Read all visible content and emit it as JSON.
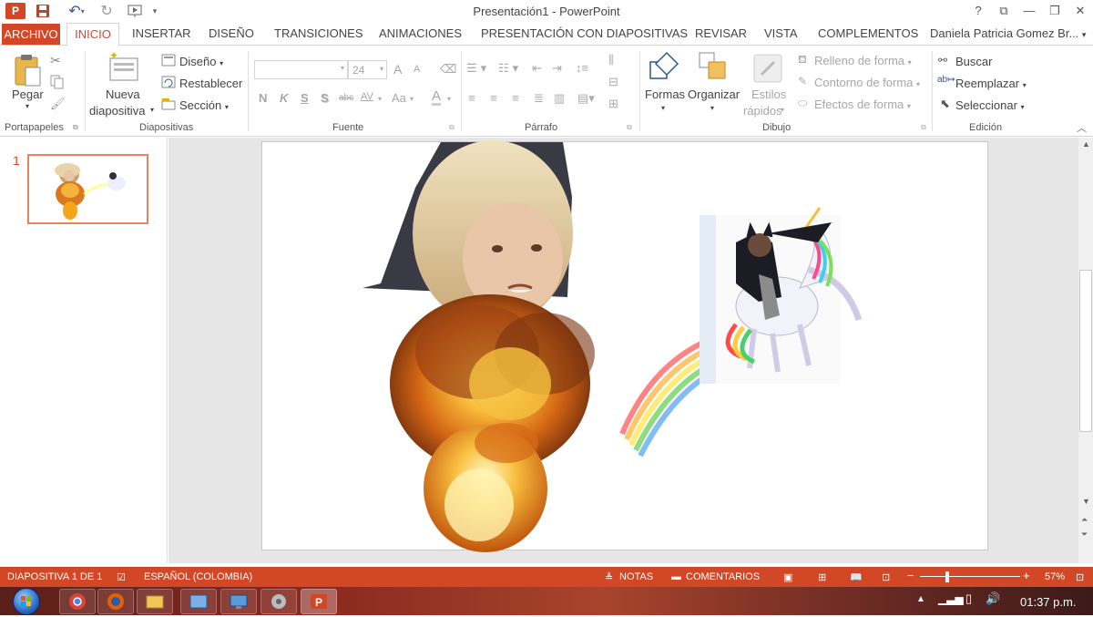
{
  "app": {
    "title": "Presentación1 - PowerPoint",
    "user": "Daniela Patricia Gomez Br..."
  },
  "window_controls": {
    "help": "?",
    "restore_ribbon": "⧉",
    "minimize": "—",
    "maximize": "❐",
    "close": "✕"
  },
  "tabs": [
    "ARCHIVO",
    "INICIO",
    "INSERTAR",
    "DISEÑO",
    "TRANSICIONES",
    "ANIMACIONES",
    "PRESENTACIÓN CON DIAPOSITIVAS",
    "REVISAR",
    "VISTA",
    "COMPLEMENTOS"
  ],
  "ribbon": {
    "clipboard": {
      "paste": "Pegar",
      "label": "Portapapeles"
    },
    "slides": {
      "new_slide_1": "Nueva",
      "new_slide_2": "diapositiva",
      "layout": "Diseño",
      "reset": "Restablecer",
      "section": "Sección",
      "label": "Diapositivas"
    },
    "font": {
      "size": "24",
      "bold": "N",
      "italic": "K",
      "underline": "S",
      "shadow": "S",
      "strike": "abc",
      "spacing": "AV",
      "case": "Aa",
      "color": "A",
      "grow": "A",
      "shrink": "A",
      "label": "Fuente"
    },
    "paragraph": {
      "label": "Párrafo"
    },
    "drawing": {
      "shapes": "Formas",
      "arrange": "Organizar",
      "quick_styles_1": "Estilos",
      "quick_styles_2": "rápidos",
      "fill": "Relleno de forma",
      "outline": "Contorno de forma",
      "effects": "Efectos de forma",
      "label": "Dibujo"
    },
    "editing": {
      "find": "Buscar",
      "replace": "Reemplazar",
      "select": "Seleccionar",
      "label": "Edición"
    }
  },
  "thumbnails": [
    {
      "number": "1"
    }
  ],
  "status": {
    "slide": "DIAPOSITIVA 1 DE 1",
    "language": "ESPAÑOL (COLOMBIA)",
    "notes": "NOTAS",
    "comments": "COMENTARIOS",
    "zoom": "57%"
  },
  "taskbar": {
    "time": "01:37 p.m."
  },
  "colors": {
    "accent": "#d24726"
  }
}
